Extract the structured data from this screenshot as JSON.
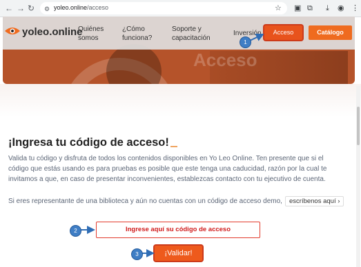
{
  "browser": {
    "url_host": "yoleo.online",
    "url_path": "/acceso",
    "icons": [
      "back-icon",
      "forward-icon",
      "reload-icon",
      "site-settings-icon",
      "bookmark-star-icon",
      "screenshot-icon",
      "extensions-icon",
      "download-icon",
      "profile-icon",
      "menu-icon"
    ]
  },
  "header": {
    "logo": {
      "name": "yoleo",
      "tld": ".online"
    },
    "nav": [
      {
        "line1": "Quiénes",
        "line2": "somos"
      },
      {
        "line1": "¿Cómo",
        "line2": "funciona?"
      },
      {
        "line1": "Soporte y",
        "line2": "capacitación"
      },
      {
        "line1": "Inversión",
        "line2": ""
      }
    ],
    "acceso_label": "Acceso",
    "catalogo_label": "Catálogo",
    "hero_watermark": "Acceso"
  },
  "main": {
    "heading": "¡Ingresa tu código de acceso!",
    "paragraph1": "Valida tu código y disfruta de todos los contenidos disponibles en Yo Leo Online. Ten presente que si el código que estás usando es para pruebas es posible que este tenga una caducidad, razón por la cual te invitamos a que, en caso de presentar inconvenientes, establezcas contacto con tu ejecutivo de cuenta.",
    "paragraph2": "Si eres representante de una biblioteca y aún no cuentas con un código de acceso demo,",
    "escribenos_label": "escríbenos aquí ›",
    "code_input_placeholder": "Ingrese aquí su código de acceso",
    "validar_label": "¡Validar!"
  },
  "annotations": {
    "step1": "1",
    "step2": "2",
    "step3": "3"
  },
  "colors": {
    "accent": "#ee5a1c",
    "callout": "#3f7ec5",
    "input_border": "#e23a2c"
  }
}
